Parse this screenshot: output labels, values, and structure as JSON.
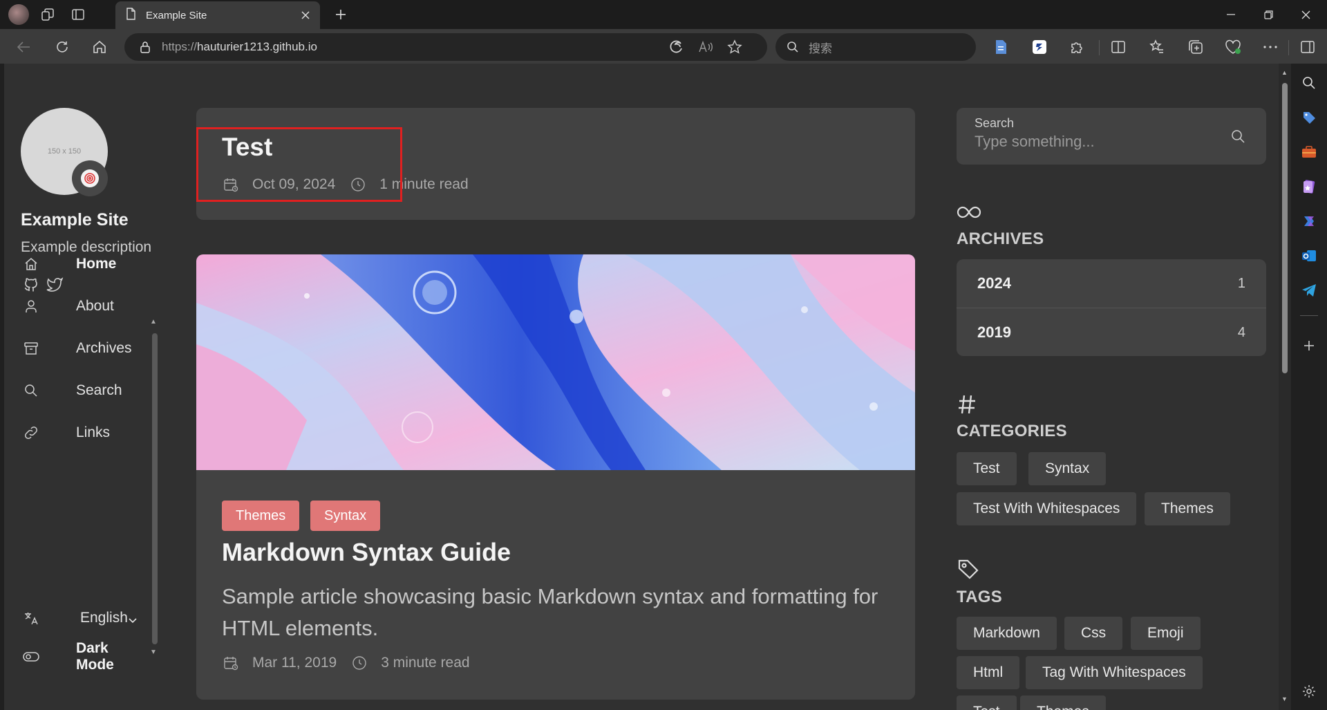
{
  "browser": {
    "tab_title": "Example Site",
    "url_scheme": "https://",
    "url_host": "hauturier1213.github.io",
    "search_placeholder": "搜索"
  },
  "site": {
    "avatar_placeholder": "150 x 150",
    "title": "Example Site",
    "description": "Example description",
    "menu": [
      {
        "label": "Home",
        "icon": "home-icon",
        "active": true
      },
      {
        "label": "About",
        "icon": "user-icon",
        "active": false
      },
      {
        "label": "Archives",
        "icon": "archive-icon",
        "active": false
      },
      {
        "label": "Search",
        "icon": "search-icon",
        "active": false
      },
      {
        "label": "Links",
        "icon": "link-icon",
        "active": false
      }
    ],
    "language": "English",
    "dark_mode": "Dark Mode"
  },
  "posts": [
    {
      "title": "Test",
      "date": "Oct 09, 2024",
      "read_time": "1 minute read"
    },
    {
      "categories": [
        "Themes",
        "Syntax"
      ],
      "title": "Markdown Syntax Guide",
      "excerpt": "Sample article showcasing basic Markdown syntax and formatting for HTML elements.",
      "date": "Mar 11, 2019",
      "read_time": "3 minute read"
    }
  ],
  "sidebar_right": {
    "search_label": "Search",
    "search_placeholder": "Type something...",
    "archives_title": "ARCHIVES",
    "archives": [
      {
        "year": "2024",
        "count": "1"
      },
      {
        "year": "2019",
        "count": "4"
      }
    ],
    "categories_title": "CATEGORIES",
    "categories": [
      "Test",
      "Syntax",
      "Test With Whitespaces",
      "Themes"
    ],
    "tags_title": "TAGS",
    "tags": [
      "Markdown",
      "Css",
      "Emoji",
      "Html",
      "Tag With Whitespaces",
      "Test",
      "Themes"
    ]
  },
  "colors": {
    "accent_pill": "#e07777",
    "card_bg": "#424242",
    "page_bg": "#303030"
  }
}
